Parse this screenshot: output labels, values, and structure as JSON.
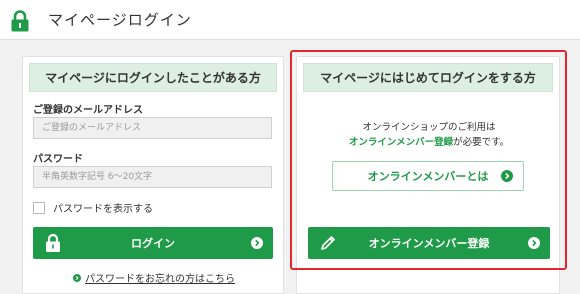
{
  "header": {
    "title": "マイページログイン"
  },
  "left_panel": {
    "heading": "マイページにログインしたことがある方",
    "email_label": "ご登録のメールアドレス",
    "email_placeholder": "ご登録のメールアドレス",
    "password_label": "パスワード",
    "password_placeholder": "半角英数字記号 6～20文字",
    "show_password_label": "パスワードを表示する",
    "login_button": "ログイン",
    "forgot_link": "パスワードをお忘れの方はこちら"
  },
  "right_panel": {
    "heading": "マイページにはじめてログインをする方",
    "info_line1": "オンラインショップのご利用は",
    "info_strong": "オンラインメンバー登録",
    "info_suffix": "が必要です。",
    "about_button": "オンラインメンバーとは",
    "register_button": "オンラインメンバー登録"
  },
  "colors": {
    "brand_green": "#1f9a48",
    "highlight_red": "#e8252c",
    "header_tint": "#dcefe2"
  }
}
